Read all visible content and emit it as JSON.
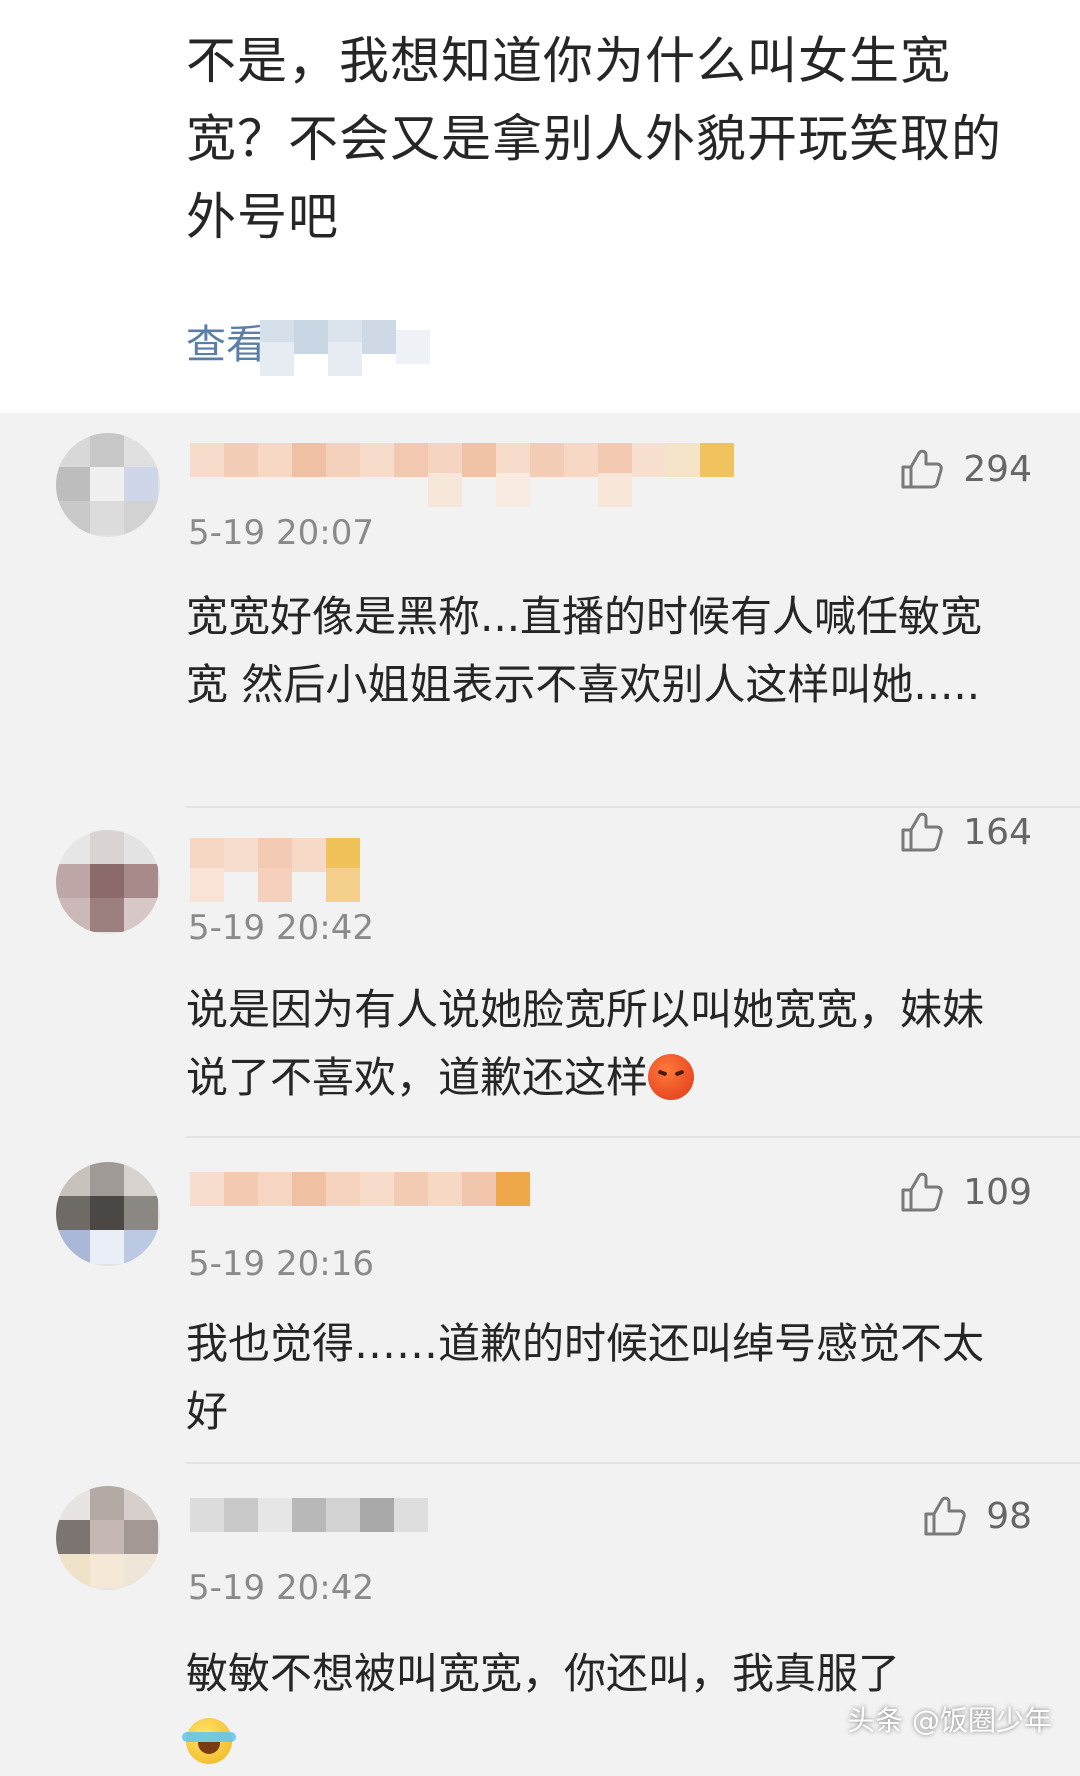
{
  "top_comment": {
    "text": "不是，我想知道你为什么叫女生宽宽？不会又是拿别人外貌开玩笑取的外号吧",
    "view_more": "查看"
  },
  "comments": [
    {
      "likes": "294",
      "time": "5-19 20:07",
      "text": "宽宽好像是黑称...直播的时候有人喊任敏宽宽 然后小姐姐表示不喜欢别人这样叫她.....",
      "emoji": ""
    },
    {
      "likes": "164",
      "time": "5-19 20:42",
      "text": "说是因为有人说她脸宽所以叫她宽宽，妹妹说了不喜欢，道歉还这样",
      "emoji": "angry-face-icon"
    },
    {
      "likes": "109",
      "time": "5-19 20:16",
      "text": "我也觉得……道歉的时候还叫绰号感觉不太好",
      "emoji": ""
    },
    {
      "likes": "98",
      "time": "5-19 20:42",
      "text": "敏敏不想被叫宽宽，你还叫，我真服了",
      "emoji": "crying-laughing-face-icon"
    }
  ],
  "watermark": "头条 @饭圈少年",
  "colors": {
    "background": "#f2f2f2",
    "top_background": "#ffffff",
    "link": "#5b7ea6",
    "meta_text": "#8a8a8a"
  }
}
